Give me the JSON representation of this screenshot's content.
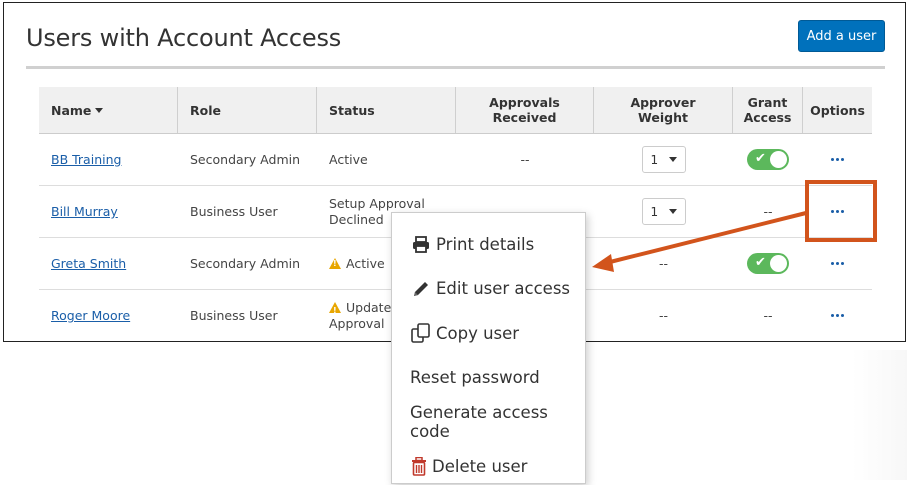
{
  "header": {
    "title": "Users with Account Access",
    "add_user_label": "Add a user"
  },
  "table": {
    "columns": {
      "name": "Name",
      "role": "Role",
      "status": "Status",
      "approvals_received": "Approvals Received",
      "approver_weight": "Approver Weight",
      "grant_access": "Grant Access",
      "options": "Options"
    },
    "rows": [
      {
        "name": "BB Training",
        "role": "Secondary Admin",
        "status": "Active",
        "approvals": "--",
        "weight": "1",
        "grant_access": "on"
      },
      {
        "name": "Bill Murray",
        "role": "Business User",
        "status_line1": "Setup Approval",
        "status_line2": "Declined",
        "weight": "1",
        "grant_access": "--"
      },
      {
        "name": "Greta Smith",
        "role": "Secondary Admin",
        "status": "Active",
        "approvals": "--",
        "grant_access": "on"
      },
      {
        "name": "Roger Moore",
        "role": "Business User",
        "status_line1": "Update I",
        "status_line2": "Approval",
        "approvals": "--",
        "grant_access": "--"
      }
    ]
  },
  "menu": {
    "items": [
      {
        "label": "Print details",
        "icon": "printer-icon"
      },
      {
        "label": "Edit user access",
        "icon": "pencil-icon"
      },
      {
        "label": "Copy user",
        "icon": "copy-icon"
      },
      {
        "label": "Reset password"
      },
      {
        "label": "Generate access code"
      },
      {
        "label": "Delete user",
        "icon": "trash-icon"
      }
    ]
  },
  "colors": {
    "primary": "#0071bc",
    "link": "#1a5ea8",
    "toggle_on": "#5cb85c",
    "warning": "#e8a600",
    "annotation": "#d2541c",
    "delete_icon": "#c0392b"
  }
}
